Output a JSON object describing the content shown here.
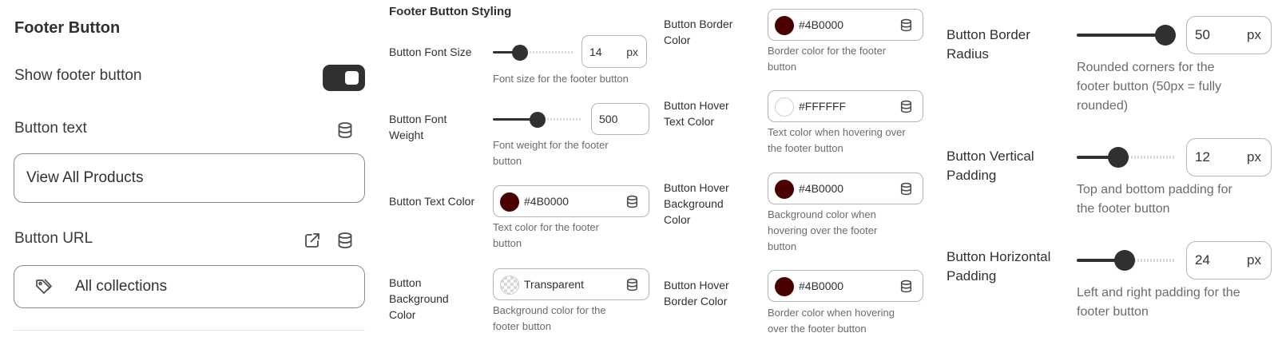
{
  "footer_button": {
    "title": "Footer Button",
    "show_label": "Show footer button",
    "show_enabled": true,
    "text_label": "Button text",
    "text_value": "View All Products",
    "url_label": "Button URL",
    "url_value": "All collections"
  },
  "styling": {
    "title": "Footer Button Styling",
    "font_size": {
      "label": "Button Font Size",
      "value": "14",
      "unit": "px",
      "help": "Font size for the footer button",
      "level": 0.3
    },
    "font_weight": {
      "label_line1": "Button Font",
      "label_line2": "Weight",
      "value": "500",
      "help_line1": "Font weight for the footer",
      "help_line2": "button",
      "level": 0.5
    },
    "text_color": {
      "label": "Button Text Color",
      "value": "#4B0000",
      "help_line1": "Text color for the footer",
      "help_line2": "button",
      "color": "#4B0000"
    },
    "bg_color": {
      "label_line1": "Button",
      "label_line2": "Background",
      "label_line3": "Color",
      "value": "Transparent",
      "help_line1": "Background color for the",
      "help_line2": "footer button"
    }
  },
  "colors": {
    "border_color": {
      "label_line1": "Button Border",
      "label_line2": "Color",
      "value": "#4B0000",
      "help_line1": "Border color for the footer",
      "help_line2": "button",
      "color": "#4B0000"
    },
    "hover_text": {
      "label_line1": "Button Hover",
      "label_line2": "Text Color",
      "value": "#FFFFFF",
      "help_line1": "Text color when hovering over",
      "help_line2": "the footer button",
      "color": "#FFFFFF"
    },
    "hover_bg": {
      "label_line1": "Button Hover",
      "label_line2": "Background",
      "label_line3": "Color",
      "value": "#4B0000",
      "help_line1": "Background color when",
      "help_line2": "hovering over the footer",
      "help_line3": "button",
      "color": "#4B0000"
    },
    "hover_border": {
      "label_line1": "Button Hover",
      "label_line2": "Border Color",
      "value": "#4B0000",
      "help_line1": "Border color when hovering",
      "help_line2": "over the footer button",
      "color": "#4B0000"
    }
  },
  "layout": {
    "border_radius": {
      "label_line1": "Button Border",
      "label_line2": "Radius",
      "value": "50",
      "unit": "px",
      "help_line1": "Rounded corners for the",
      "help_line2": "footer button (50px = fully",
      "help_line3": "rounded)",
      "level": 1.0
    },
    "vertical_padding": {
      "label_line1": "Button Vertical",
      "label_line2": "Padding",
      "value": "12",
      "unit": "px",
      "help_line1": "Top and bottom padding for",
      "help_line2": "the footer button",
      "level": 0.4
    },
    "horizontal_padding": {
      "label_line1": "Button Horizontal",
      "label_line2": "Padding",
      "value": "24",
      "unit": "px",
      "help_line1": "Left and right padding for the",
      "help_line2": "footer button",
      "level": 0.48
    }
  }
}
